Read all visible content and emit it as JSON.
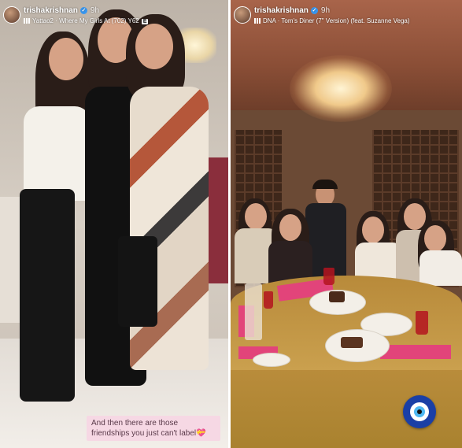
{
  "stories": [
    {
      "username": "trishakrishnan",
      "verified_mark": "✓",
      "time": "9h",
      "music_track": "Yattao2 · Where My Girls At (702) Y62",
      "explicit_label": "E",
      "caption": "And then there are those friendships you just can't label💝"
    },
    {
      "username": "trishakrishnan",
      "verified_mark": "✓",
      "time": "9h",
      "music_track": "DNA · Tom's Diner (7\" Version) (feat. Suzanne Vega)"
    }
  ],
  "colors": {
    "verified_blue": "#3897f0",
    "caption_bg": "#f6d8e4",
    "evil_eye_blue": "#1a3fa6"
  },
  "icons": {
    "music": "music-bars-icon",
    "verified": "verified-badge-icon",
    "sticker": "evil-eye-icon"
  }
}
